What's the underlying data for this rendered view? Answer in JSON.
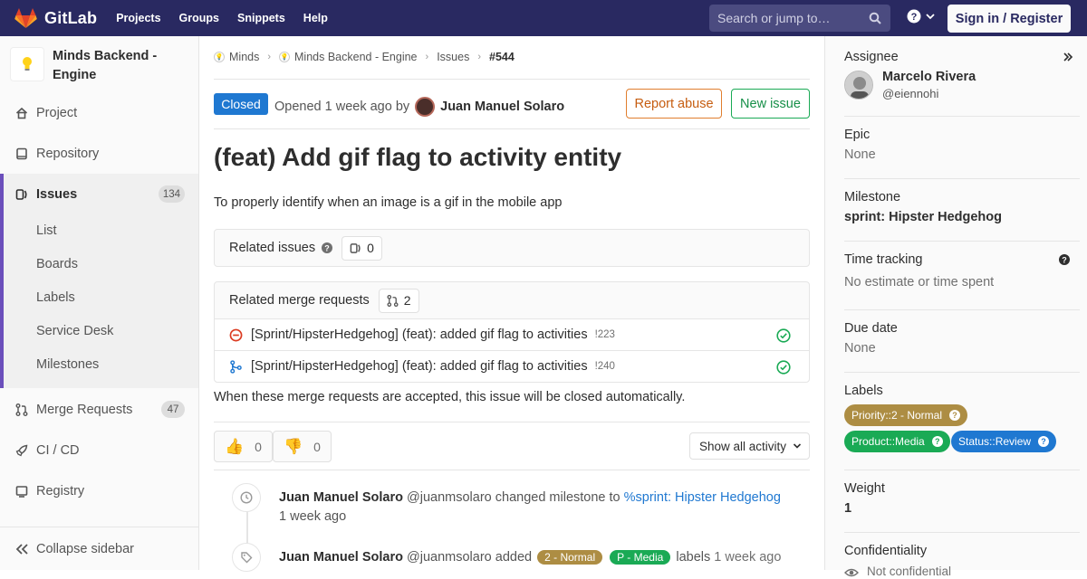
{
  "header": {
    "brand": "GitLab",
    "nav": [
      "Projects",
      "Groups",
      "Snippets",
      "Help"
    ],
    "search_placeholder": "Search or jump to…",
    "sign_in": "Sign in / Register"
  },
  "sidebar": {
    "project_name": "Minds Backend - Engine",
    "project": "Project",
    "repository": "Repository",
    "issues": "Issues",
    "issues_count": "134",
    "sub_items": [
      "List",
      "Boards",
      "Labels",
      "Service Desk",
      "Milestones"
    ],
    "merge_requests": "Merge Requests",
    "mr_count": "47",
    "cicd": "CI / CD",
    "registry": "Registry",
    "collapse": "Collapse sidebar"
  },
  "breadcrumb": {
    "group": "Minds",
    "project": "Minds Backend - Engine",
    "issues": "Issues",
    "current": "#544"
  },
  "issue": {
    "status": "Closed",
    "opened_text": "Opened 1 week ago by",
    "author": "Juan Manuel Solaro",
    "report_abuse": "Report abuse",
    "new_issue": "New issue",
    "title": "(feat) Add gif flag to activity entity",
    "description": "To properly identify when an image is a gif in the mobile app"
  },
  "related_issues": {
    "label": "Related issues",
    "count": "0"
  },
  "related_mrs": {
    "label": "Related merge requests",
    "count": "2",
    "items": [
      {
        "title": "[Sprint/HipsterHedgehog] (feat): added gif flag to activities",
        "ref": "!223"
      },
      {
        "title": "[Sprint/HipsterHedgehog] (feat): added gif flag to activities",
        "ref": "!240"
      }
    ],
    "note": "When these merge requests are accepted, this issue will be closed automatically."
  },
  "awards": {
    "thumbs_up": "0",
    "thumbs_down": "0",
    "filter": "Show all activity"
  },
  "activity": [
    {
      "author": "Juan Manuel Solaro",
      "handle": "@juanmsolaro",
      "action": "changed milestone to",
      "link": "%sprint: Hipster Hedgehog",
      "time": "1 week ago"
    },
    {
      "author": "Juan Manuel Solaro",
      "handle": "@juanmsolaro",
      "action": "added",
      "label1": "2 - Normal",
      "label2": "P - Media",
      "suffix": "labels",
      "time": "1 week ago"
    }
  ],
  "right_sidebar": {
    "assignee_label": "Assignee",
    "assignee_name": "Marcelo Rivera",
    "assignee_handle": "@eiennohi",
    "epic_label": "Epic",
    "epic_value": "None",
    "milestone_label": "Milestone",
    "milestone_value": "sprint: Hipster Hedgehog",
    "time_label": "Time tracking",
    "time_value": "No estimate or time spent",
    "due_label": "Due date",
    "due_value": "None",
    "labels_label": "Labels",
    "labels": [
      {
        "text": "Priority::2 - Normal",
        "color": "#ad8d43"
      },
      {
        "text": "Product::Media",
        "color": "#1aaa55"
      },
      {
        "text": "Status::Review",
        "color": "#1f78d1"
      }
    ],
    "weight_label": "Weight",
    "weight_value": "1",
    "confidentiality_label": "Confidentiality",
    "confidentiality_value": "Not confidential"
  }
}
